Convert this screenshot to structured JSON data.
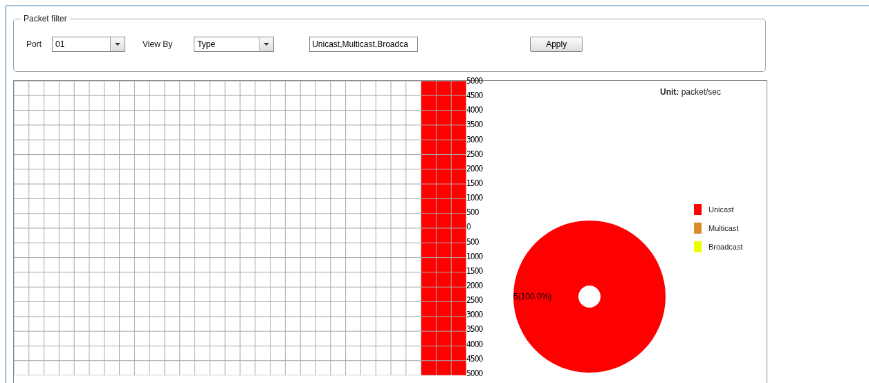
{
  "packet_filter": {
    "legend": "Packet filter",
    "port": {
      "label": "Port",
      "value": "01"
    },
    "view_by": {
      "label": "View By",
      "value": "Type"
    },
    "types_field": {
      "value": "Unicast,Multicast,Broadca"
    },
    "apply_button": "Apply"
  },
  "history_chart": {
    "upper_tick_labels": [
      "5000",
      "4500",
      "4000",
      "3500",
      "3000",
      "2500",
      "2000",
      "1500",
      "1000",
      "500",
      "0"
    ],
    "lower_tick_labels": [
      "500",
      "1000",
      "1500",
      "2000",
      "2500",
      "3000",
      "3500",
      "4000",
      "4500",
      "5000"
    ]
  },
  "unit": "**Unit:** packet/sec",
  "pie": {
    "chart_data": {
      "type": "pie",
      "categories": [
        "Unicast",
        "Multicast",
        "Broadcast"
      ],
      "values": [
        100,
        0,
        0
      ],
      "value_labels": [
        "5(100.0%)",
        null,
        null
      ]
    },
    "legend": [
      {
        "color": "#ff0000"
      },
      {
        "color": "#d98b2b"
      },
      {
        "color": "#eeff00"
      }
    ]
  }
}
